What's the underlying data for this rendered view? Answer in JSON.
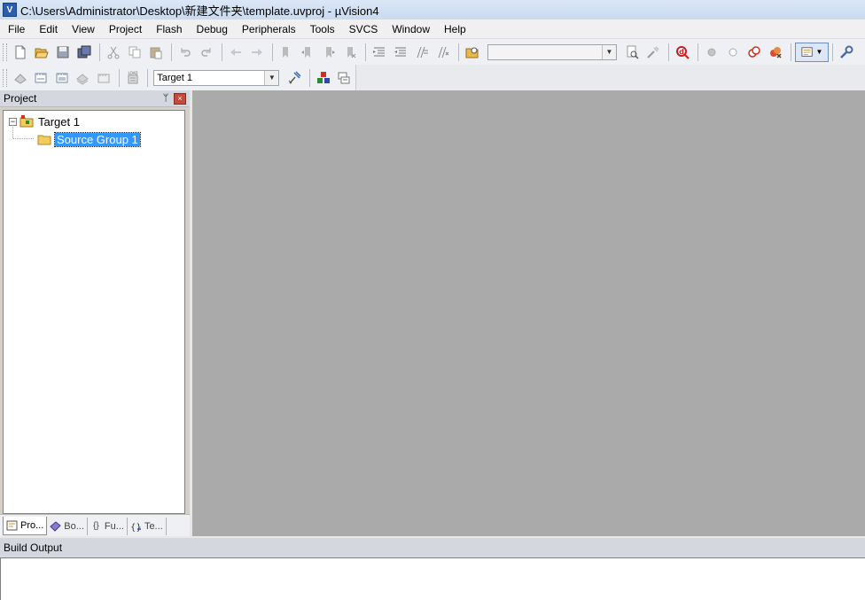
{
  "window": {
    "title": "C:\\Users\\Administrator\\Desktop\\新建文件夹\\template.uvproj - µVision4"
  },
  "menu": [
    "File",
    "Edit",
    "View",
    "Project",
    "Flash",
    "Debug",
    "Peripherals",
    "Tools",
    "SVCS",
    "Window",
    "Help"
  ],
  "toolbar": {
    "target_select": "Target 1",
    "find_combo": ""
  },
  "project_panel": {
    "title": "Project",
    "pin_glyph": "ᛘ",
    "close_glyph": "×",
    "tree": {
      "root": {
        "label": "Target 1",
        "expander": "−"
      },
      "group": {
        "label": "Source Group 1"
      }
    },
    "tabs": [
      "Pro...",
      "Bo...",
      "Fu...",
      "Te..."
    ]
  },
  "build_output": {
    "title": "Build Output"
  },
  "colors": {
    "workspace": "#aaaaaa",
    "selection": "#3399ff",
    "titlebar": "#c9daf0"
  },
  "icons": {
    "app": "uv-logo-icon",
    "toolbar1": [
      "new-file-icon",
      "open-folder-icon",
      "save-icon",
      "save-all-icon",
      "cut-icon",
      "copy-icon",
      "paste-icon",
      "undo-icon",
      "redo-icon",
      "nav-back-icon",
      "nav-forward-icon",
      "bookmark-icon",
      "bookmark-prev-icon",
      "bookmark-next-icon",
      "bookmark-clear-icon",
      "indent-icon",
      "unindent-icon",
      "comment-icon",
      "uncomment-icon",
      "find-in-files-icon",
      "find-icon",
      "incremental-find-icon",
      "debug-session-icon",
      "breakpoint-icon",
      "breakpoint-disabled-icon",
      "disable-all-breakpoints-icon",
      "kill-breakpoints-icon",
      "window-select-icon",
      "configure-icon"
    ],
    "toolbar2": [
      "translate-icon",
      "build-icon",
      "rebuild-icon",
      "batch-build-icon",
      "stop-build-icon",
      "download-icon",
      "target-options-icon",
      "manage-components-icon",
      "manage-books-icon"
    ]
  }
}
